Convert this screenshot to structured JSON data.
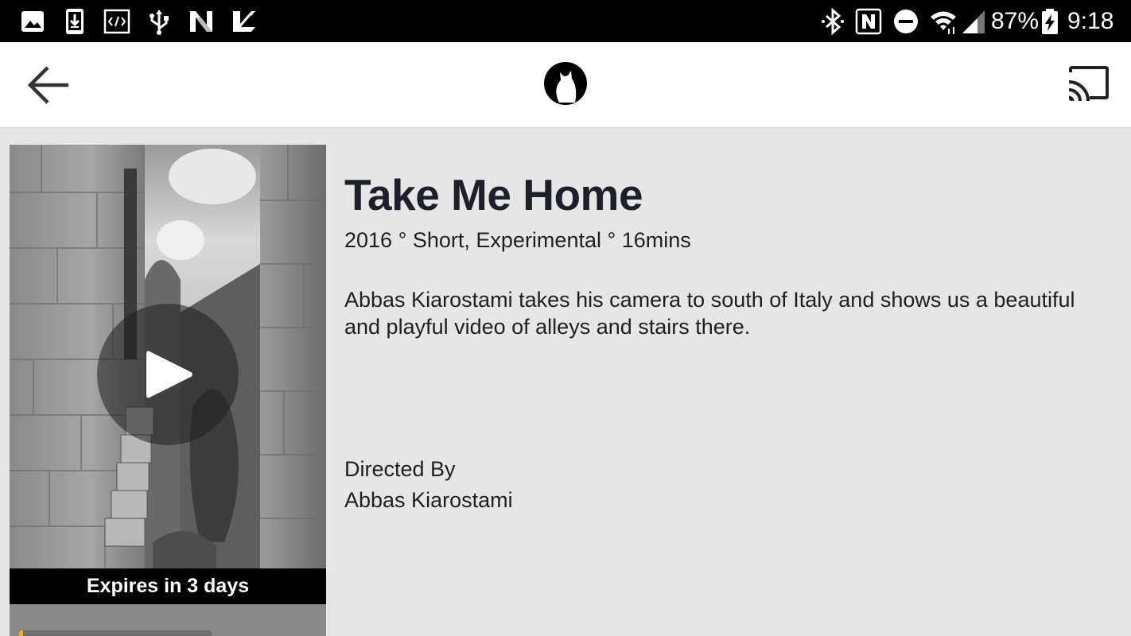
{
  "status_bar": {
    "left_icons": [
      "image-icon",
      "download-icon",
      "code-icon",
      "usb-icon",
      "n-app-icon",
      "check-app-icon"
    ],
    "right_icons": [
      "bluetooth-icon",
      "nfc-icon",
      "do-not-disturb-icon",
      "wifi-icon",
      "signal-icon",
      "battery-charging-icon"
    ],
    "battery": "87%",
    "time": "9:18"
  },
  "app_bar": {
    "back_icon": "arrow-back-icon",
    "logo_icon": "cat-logo-icon",
    "cast_icon": "cast-icon"
  },
  "film": {
    "title": "Take Me Home",
    "meta": "2016 ° Short, Experimental ° 16mins",
    "description": "Abbas Kiarostami takes his camera to south of Italy and shows us a beautiful and playful video of alleys and stairs there.",
    "directed_by_label": "Directed By",
    "director": "Abbas Kiarostami",
    "expires": "Expires in 3 days",
    "progress_fraction": 0.02
  },
  "colors": {
    "status_bar": "#000000",
    "app_bar": "#ffffff",
    "background": "#e6e6e6",
    "title": "#1f1f2b",
    "progress": "#f0b400"
  }
}
